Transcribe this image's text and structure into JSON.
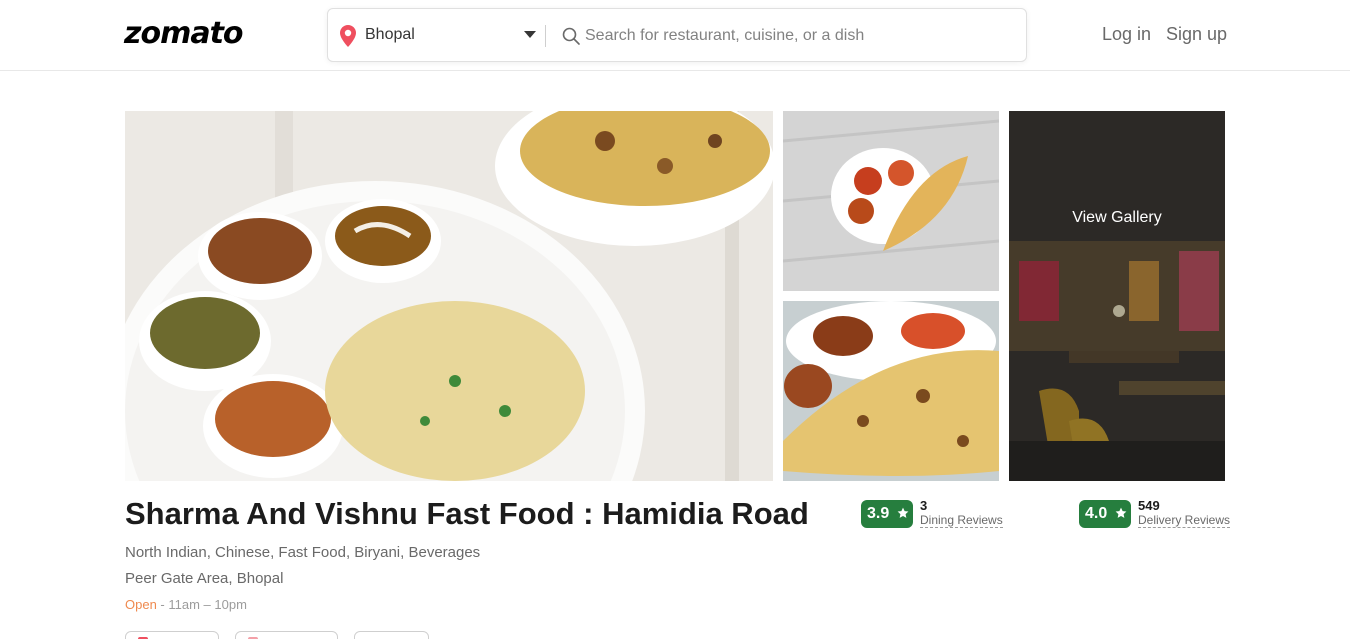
{
  "header": {
    "logo": "zomato",
    "location": "Bhopal",
    "search_placeholder": "Search for restaurant, cuisine, or a dish",
    "login_label": "Log in",
    "signup_label": "Sign up"
  },
  "gallery": {
    "view_gallery_label": "View Gallery"
  },
  "restaurant": {
    "name": "Sharma And Vishnu Fast Food : Hamidia Road",
    "cuisines": "North Indian, Chinese, Fast Food, Biryani, Beverages",
    "location": "Peer Gate Area, Bhopal",
    "open_status": "Open",
    "timing": " - 11am – 10pm"
  },
  "ratings": {
    "dining": {
      "score": "3.9",
      "count": "3",
      "label": "Dining Reviews"
    },
    "delivery": {
      "score": "4.0",
      "count": "549",
      "label": "Delivery Reviews"
    }
  },
  "colors": {
    "brand": "#000000",
    "rating_green": "#267e3e",
    "open_orange": "#ef8a4f",
    "location_pin": "#ef4f5f"
  },
  "icons": {
    "location": "location-pin-icon",
    "search": "search-icon",
    "star": "star-icon",
    "caret": "caret-down-icon"
  }
}
